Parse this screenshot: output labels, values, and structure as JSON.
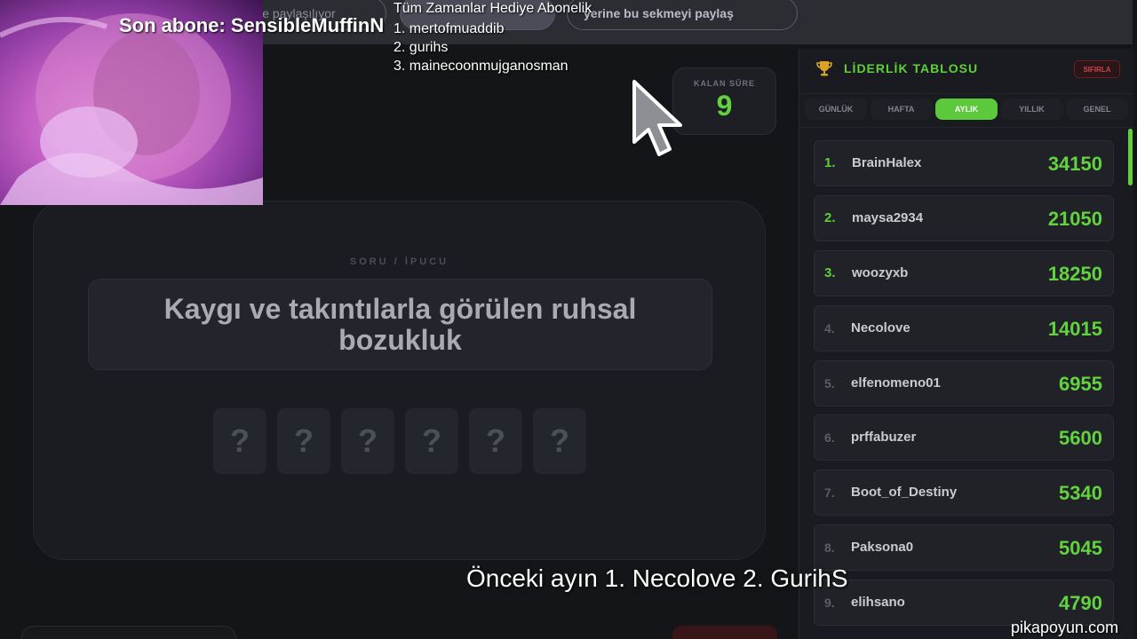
{
  "topbar": {
    "share_left": "ile paylaşılıyor",
    "share_mid": "",
    "share_right": "yerine bu sekmeyi paylaş"
  },
  "overlay": {
    "title": "Son abone: SensibleMuffinN",
    "list_heading": "Tüm Zamanlar Hediye  Abonelik",
    "list": [
      "1. mertofmuaddib",
      "2. gurihs",
      "3. mainecoonmujganosman"
    ]
  },
  "timer": {
    "label": "KALAN SÜRE",
    "value": "9"
  },
  "question": {
    "label": "SORU / İPUCU",
    "text": "Kaygı ve takıntılarla görülen ruhsal bozukluk",
    "tiles": [
      "?",
      "?",
      "?",
      "?",
      "?",
      "?"
    ]
  },
  "leaderboard": {
    "title": "LİDERLİK TABLOSU",
    "reset_label": "SIFIRLA",
    "tabs": [
      "GÜNLÜK",
      "HAFTA",
      "AYLIK",
      "YILLIK",
      "GENEL"
    ],
    "active_tab": "AYLIK",
    "rows": [
      {
        "rank": "1.",
        "name": "BrainHalex",
        "score": "34150"
      },
      {
        "rank": "2.",
        "name": "maysa2934",
        "score": "21050"
      },
      {
        "rank": "3.",
        "name": "woozyxb",
        "score": "18250"
      },
      {
        "rank": "4.",
        "name": "Necolove",
        "score": "14015"
      },
      {
        "rank": "5.",
        "name": "elfenomeno01",
        "score": "6955"
      },
      {
        "rank": "6.",
        "name": "prffabuzer",
        "score": "5600"
      },
      {
        "rank": "7.",
        "name": "Boot_of_Destiny",
        "score": "5340"
      },
      {
        "rank": "8.",
        "name": "Paksona0",
        "score": "5045"
      },
      {
        "rank": "9.",
        "name": "elihsano",
        "score": "4790"
      }
    ]
  },
  "subtitle": "Önceki ayın 1. Necolove 2. GurihS",
  "watermark": "pikapoyun.com",
  "colors": {
    "accent": "#5fcf3a",
    "background": "#141518",
    "danger": "#d2434b"
  },
  "icons": {
    "leaderboard": "trophy-icon",
    "cursor": "mouse-pointer-icon"
  }
}
